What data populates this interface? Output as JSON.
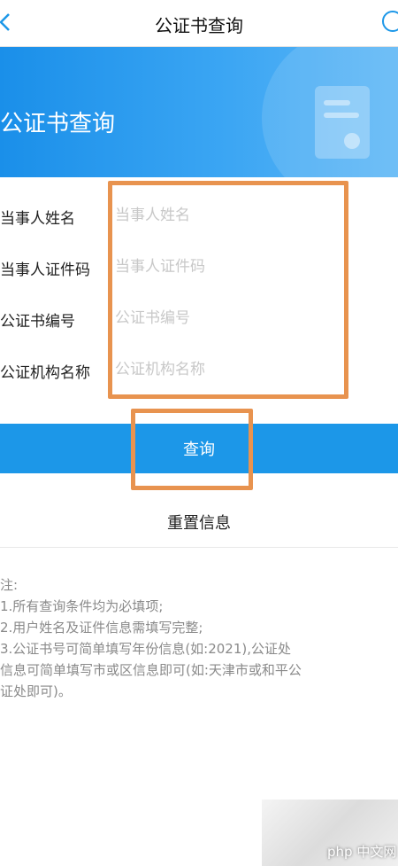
{
  "nav": {
    "title": "公证书查询"
  },
  "banner": {
    "title": "公证书查询"
  },
  "form": {
    "fields": [
      {
        "label": "当事人姓名",
        "placeholder": "当事人姓名"
      },
      {
        "label": "当事人证件码",
        "placeholder": "当事人证件码"
      },
      {
        "label": "公证书编号",
        "placeholder": "公证书编号"
      },
      {
        "label": "公证机构名称",
        "placeholder": "公证机构名称"
      }
    ],
    "query_label": "查询",
    "reset_label": "重置信息"
  },
  "notes": {
    "heading": "注:",
    "lines": [
      "1.所有查询条件均为必填项;",
      "2.用户姓名及证件信息需填写完整;",
      "3.公证书号可简单填写年份信息(如:2021),公证处",
      "信息可简单填写市或区信息即可(如:天津市或和平公",
      "证处即可)。"
    ]
  },
  "watermark": {
    "text": "php 中文网"
  },
  "colors": {
    "accent": "#1c97e8",
    "highlight": "#e8934f"
  }
}
